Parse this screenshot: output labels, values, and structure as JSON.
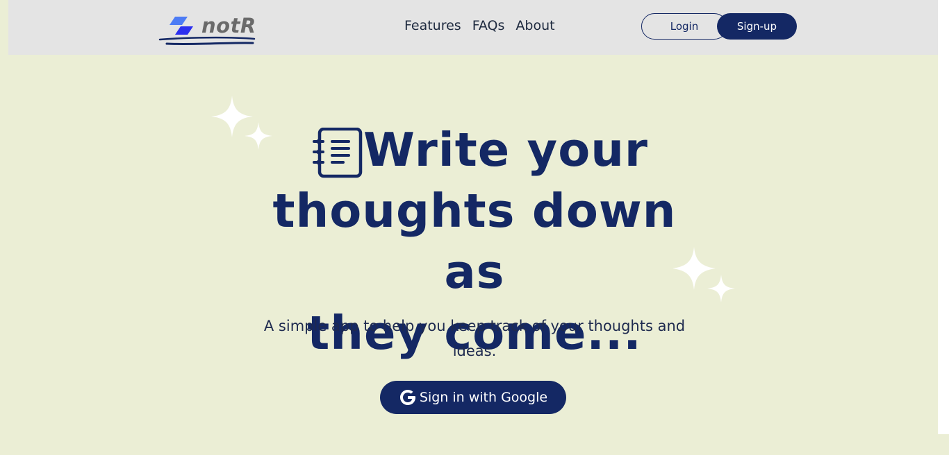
{
  "brand": {
    "name": "notR",
    "colors": {
      "primary": "#142864",
      "accent_dark": "#2c2ff0",
      "accent_light": "#4d7cf5",
      "background": "#ebeed5",
      "navbar": "#e4e4e4"
    }
  },
  "nav": {
    "links": [
      "Features",
      "FAQs",
      "About"
    ],
    "login_label": "Login",
    "signup_label": "Sign-up"
  },
  "hero": {
    "title_line1": "Write your",
    "title_line2": "thoughts down as",
    "title_line3": "they come...",
    "subtitle": "A simple app to help you keep track of your thoughts and ideas.",
    "cta_label": "Sign in with Google",
    "icons": [
      "notes-list-icon",
      "sparkle-icon",
      "google-icon"
    ]
  }
}
